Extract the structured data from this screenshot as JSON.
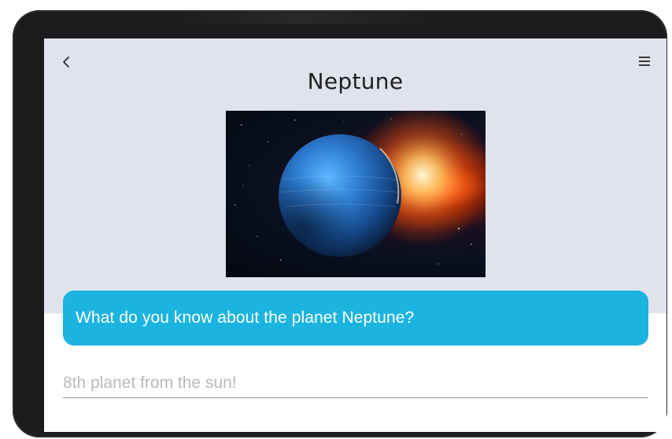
{
  "header": {
    "back_icon": "chevron-left-icon",
    "menu_icon": "hamburger-menu-icon",
    "title": "Neptune"
  },
  "image": {
    "subject": "planet-neptune-in-space"
  },
  "prompt": {
    "question": "What do you know about the planet Neptune?",
    "background_color": "#1bb4e0"
  },
  "answer": {
    "placeholder": "8th planet from the sun!",
    "value": ""
  }
}
